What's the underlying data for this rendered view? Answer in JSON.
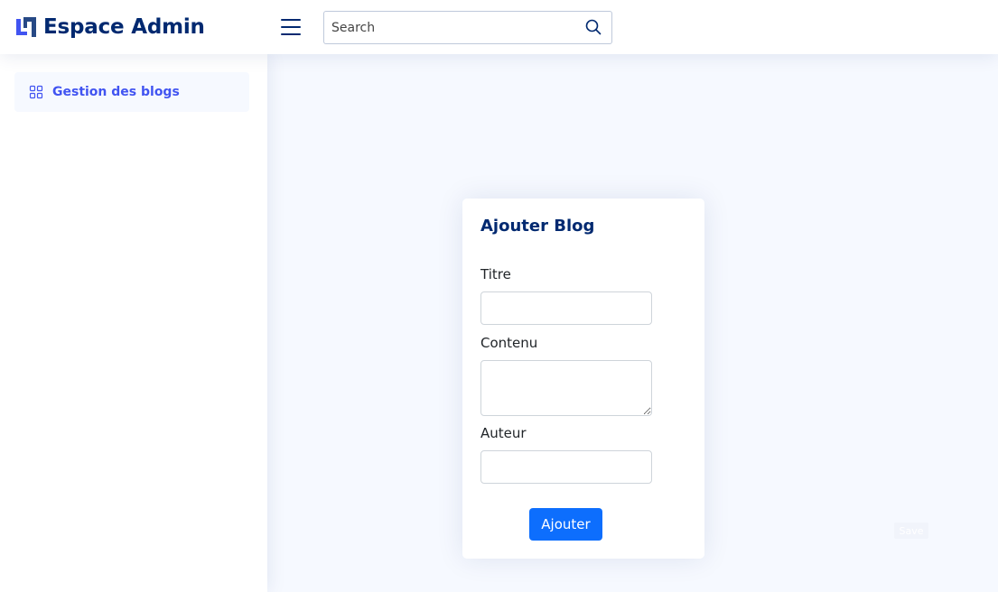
{
  "header": {
    "logo_text": "Espace Admin",
    "search": {
      "placeholder": "Search",
      "value": ""
    }
  },
  "sidebar": {
    "items": [
      {
        "label": "Gestion des blogs",
        "icon": "grid-icon",
        "active": true
      }
    ]
  },
  "form": {
    "title": "Ajouter Blog",
    "fields": [
      {
        "label": "Titre",
        "value": ""
      },
      {
        "label": "Contenu",
        "value": ""
      },
      {
        "label": "Auteur",
        "value": ""
      }
    ],
    "submit_label": "Ajouter"
  },
  "floating": {
    "save_label": "Save"
  },
  "colors": {
    "brand": "#012970",
    "accent": "#4154f1",
    "primary_button": "#0d6efd",
    "background": "#f6f9ff"
  }
}
